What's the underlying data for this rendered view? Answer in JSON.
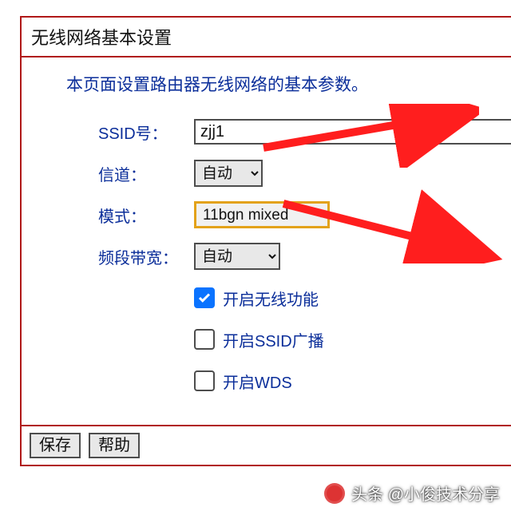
{
  "panel": {
    "title": "无线网络基本设置",
    "intro": "本页面设置路由器无线网络的基本参数。"
  },
  "form": {
    "ssid_label": "SSID号：",
    "ssid_value": "zjj1",
    "channel_label": "信道：",
    "channel_value": "自动",
    "mode_label": "模式：",
    "mode_value": "11bgn mixed",
    "bw_label": "频段带宽：",
    "bw_value": "自动"
  },
  "checks": {
    "wifi_enable": {
      "label": "开启无线功能",
      "checked": true
    },
    "ssid_bcast": {
      "label": "开启SSID广播",
      "checked": false
    },
    "wds": {
      "label": "开启WDS",
      "checked": false
    }
  },
  "buttons": {
    "save": "保存",
    "help": "帮助"
  },
  "watermark": "头条 @小俊技术分享"
}
